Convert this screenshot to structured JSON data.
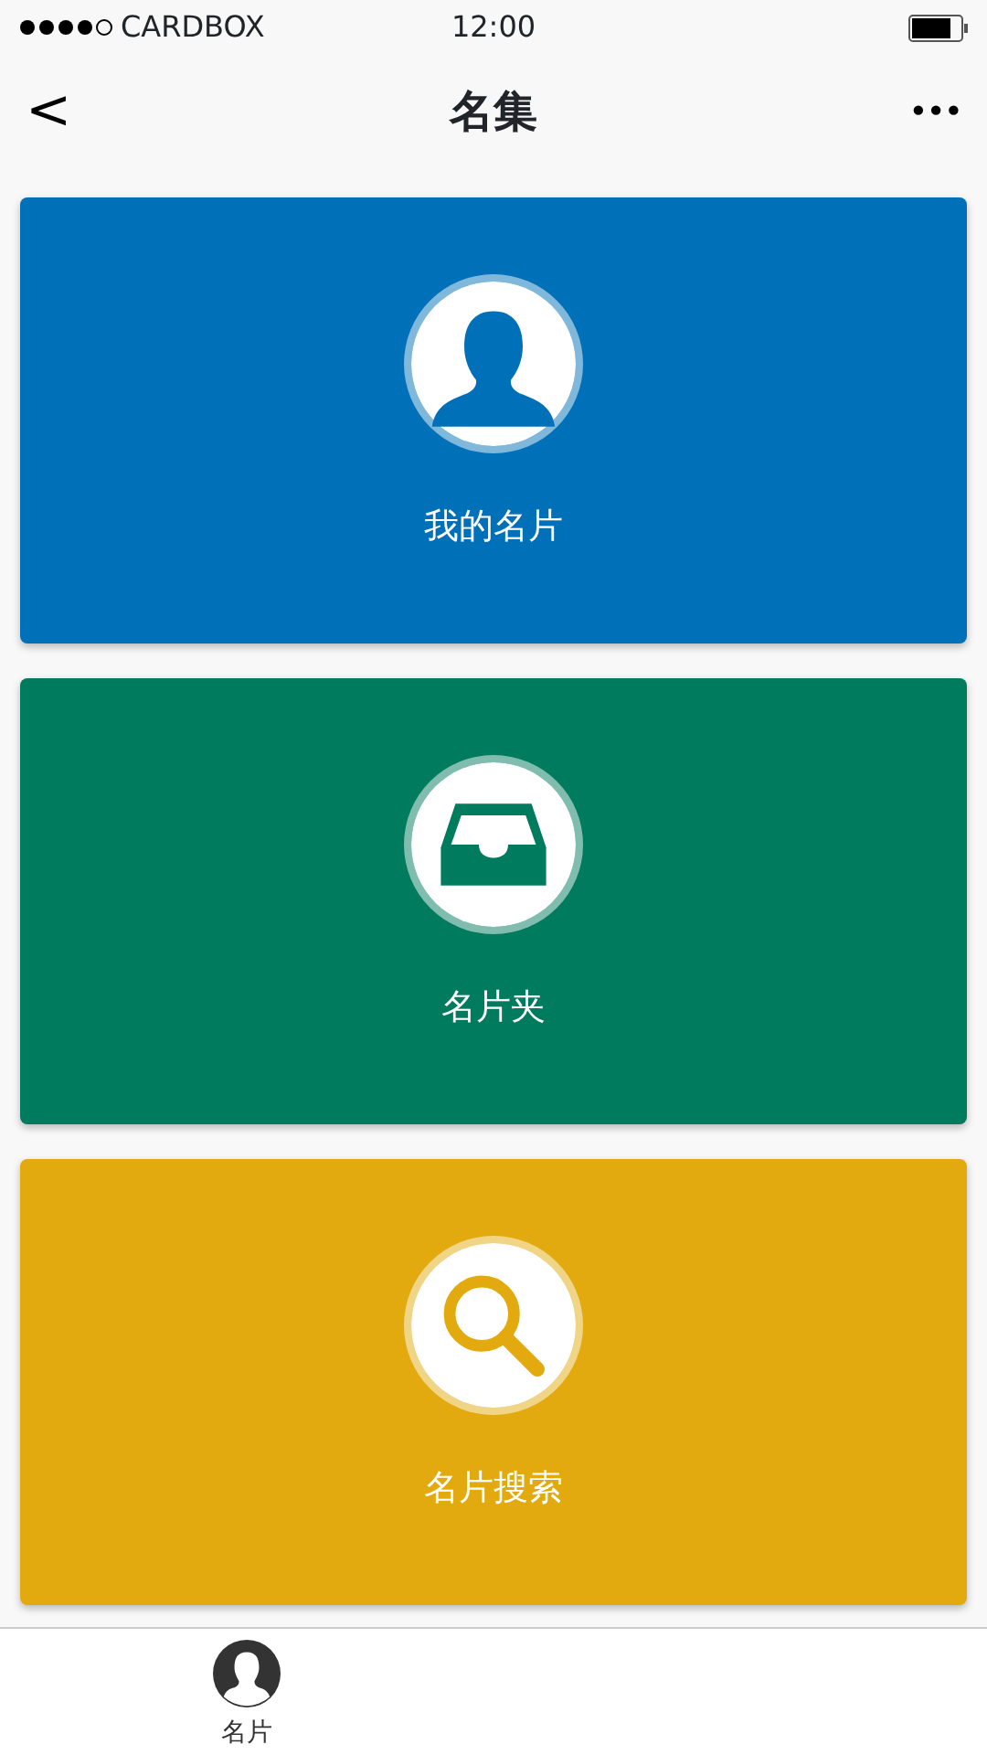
{
  "status_bar": {
    "carrier": "CARDBOX",
    "time": "12:00"
  },
  "nav": {
    "title": "名集",
    "back": "<",
    "more": "•••"
  },
  "cards": [
    {
      "label": "我的名片",
      "kind": "person",
      "color": "#0070b8"
    },
    {
      "label": "名片夹",
      "kind": "tray",
      "color": "#007b5e"
    },
    {
      "label": "名片搜索",
      "kind": "search",
      "color": "#e3aa0f"
    }
  ],
  "tab_bar": [
    {
      "label": "名片",
      "selected": true
    }
  ]
}
